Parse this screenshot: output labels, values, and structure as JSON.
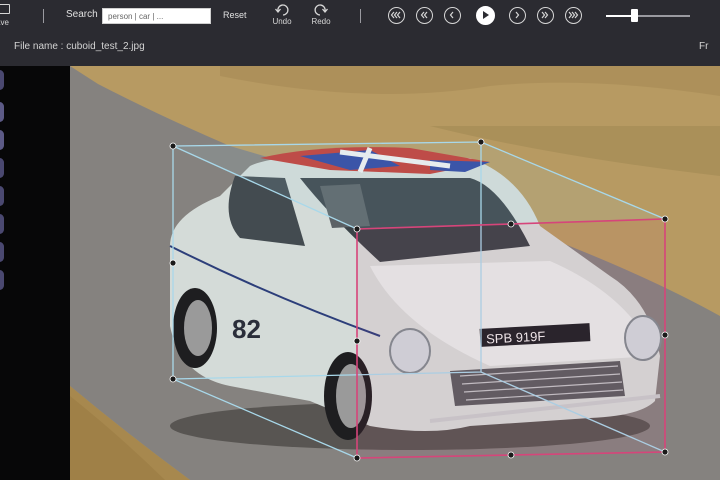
{
  "toolbar": {
    "save_label": "ave",
    "search_label": "Search",
    "search_value": "person | car | ...",
    "reset_label": "Reset",
    "undo_label": "Undo",
    "redo_label": "Redo",
    "playback_icons": [
      "skip-to-start-icon",
      "previous-page-icon",
      "previous-frame-icon",
      "play-icon",
      "next-frame-icon",
      "next-page-icon",
      "skip-to-end-icon"
    ],
    "speed_level": 0.33
  },
  "file": {
    "label": "File name : cuboid_test_2.jpg",
    "right_label": "Fr"
  },
  "annotation": {
    "front_face_color": "#d6457a",
    "back_face_color": "#a8d8ea"
  }
}
